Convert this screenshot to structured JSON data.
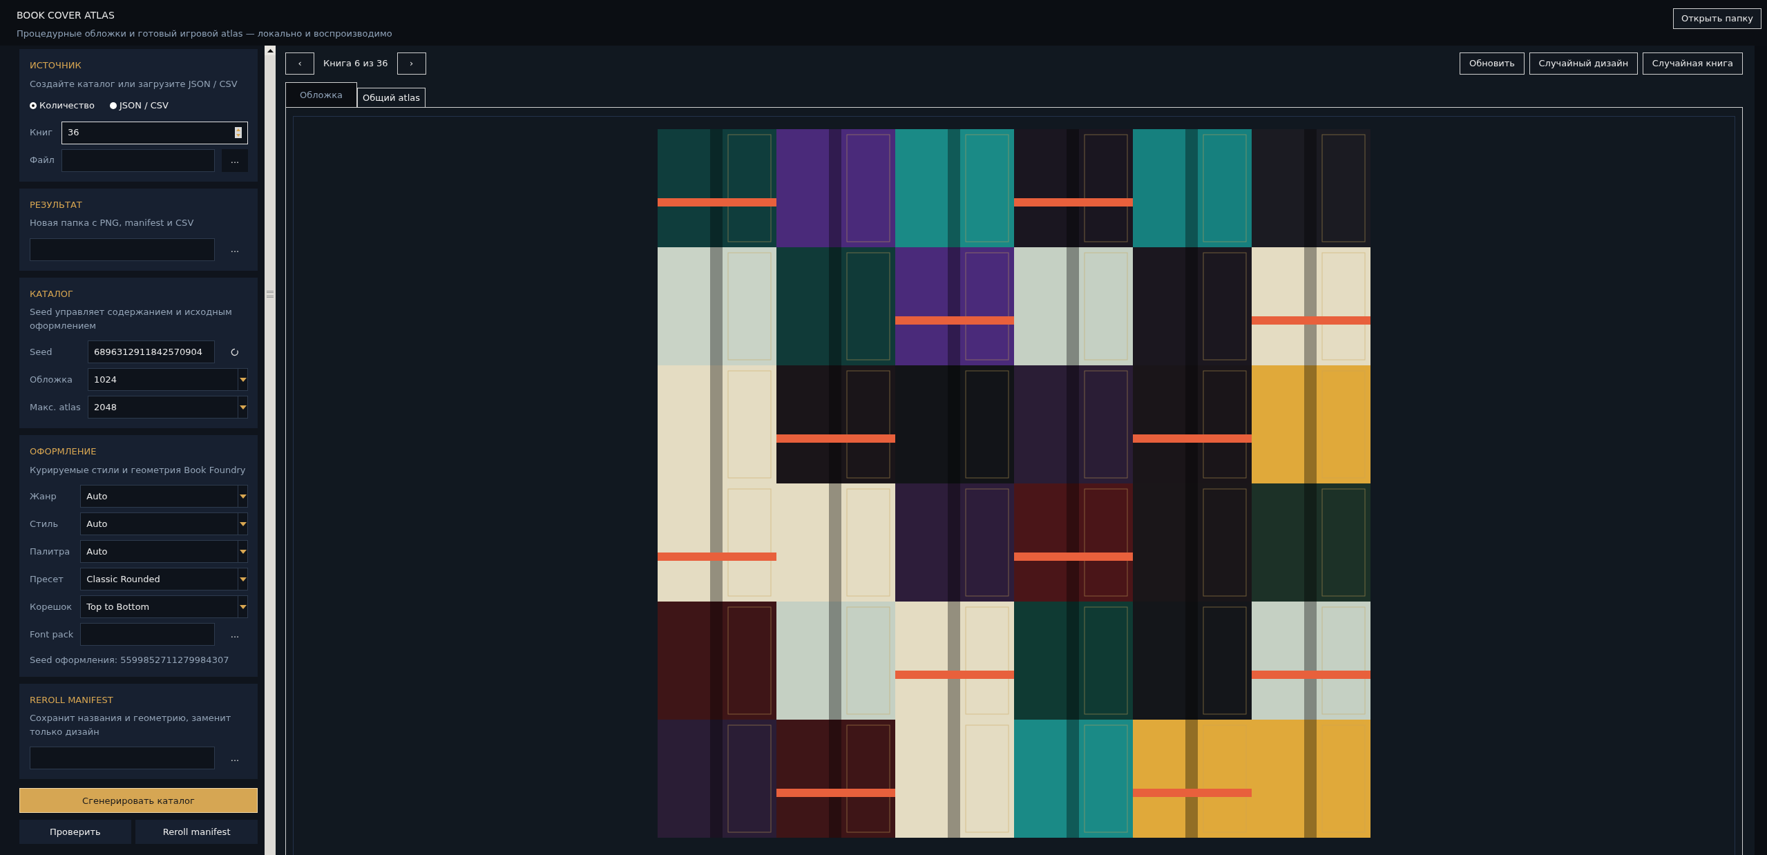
{
  "header": {
    "title": "BOOK COVER ATLAS",
    "subtitle": "Процедурные обложки и готовый игровой atlas — локально и воспроизводимо",
    "open_folder_button": "Открыть папку"
  },
  "sidebar": {
    "sections": [
      {
        "heading": "ИСТОЧНИК",
        "description": "Создайте каталог или загрузите JSON / CSV",
        "rows": [
          {
            "kind": "radios",
            "options": [
              {
                "label": "Количество",
                "selected": true
              },
              {
                "label": "JSON / CSV",
                "selected": false
              }
            ]
          },
          {
            "kind": "spin",
            "label": "Книг",
            "value": "36"
          },
          {
            "kind": "file",
            "label": "Файл",
            "button": "..."
          }
        ]
      },
      {
        "heading": "РЕЗУЛЬТАТ",
        "description": "Новая папка с PNG, manifest и CSV",
        "rows": [
          {
            "kind": "file",
            "button": "..."
          }
        ]
      },
      {
        "heading": "КАТАЛОГ",
        "description": "Seed управляет содержанием и исходным оформлением",
        "rows": [
          {
            "kind": "seed",
            "label": "Seed",
            "value": "6896312911842570904"
          },
          {
            "kind": "select",
            "label": "Обложка",
            "value": "1024"
          },
          {
            "kind": "select",
            "label": "Макс. atlas",
            "value": "2048"
          }
        ]
      },
      {
        "heading": "ОФОРМЛЕНИЕ",
        "description": "Курируемые стили и геометрия Book Foundry",
        "rows": [
          {
            "kind": "select",
            "label": "Жанр",
            "value": "Auto"
          },
          {
            "kind": "select",
            "label": "Стиль",
            "value": "Auto"
          },
          {
            "kind": "select",
            "label": "Палитра",
            "value": "Auto"
          },
          {
            "kind": "select",
            "label": "Пресет",
            "value": "Classic Rounded"
          },
          {
            "kind": "select",
            "label": "Корешок",
            "value": "Top to Bottom"
          },
          {
            "kind": "file",
            "label": "Font pack",
            "button": "..."
          },
          {
            "kind": "note",
            "text": "Seed оформления: 5599852711279984307"
          }
        ]
      },
      {
        "heading": "REROLL MANIFEST",
        "description": "Сохранит названия и геометрию, заменит только дизайн",
        "rows": [
          {
            "kind": "file",
            "button": "..."
          }
        ]
      }
    ],
    "primary_button": "Сгенерировать каталог",
    "secondary_buttons": [
      "Проверить",
      "Reroll manifest"
    ]
  },
  "main": {
    "nav": {
      "prev": "‹",
      "label": "Книга 6 из 36",
      "next": "›"
    },
    "toolbar_buttons": [
      "Обновить",
      "Случайный дизайн",
      "Случайная книга"
    ],
    "tabs": [
      {
        "label": "Обложка",
        "selected": false
      },
      {
        "label": "Общий atlas",
        "selected": true
      }
    ]
  }
}
